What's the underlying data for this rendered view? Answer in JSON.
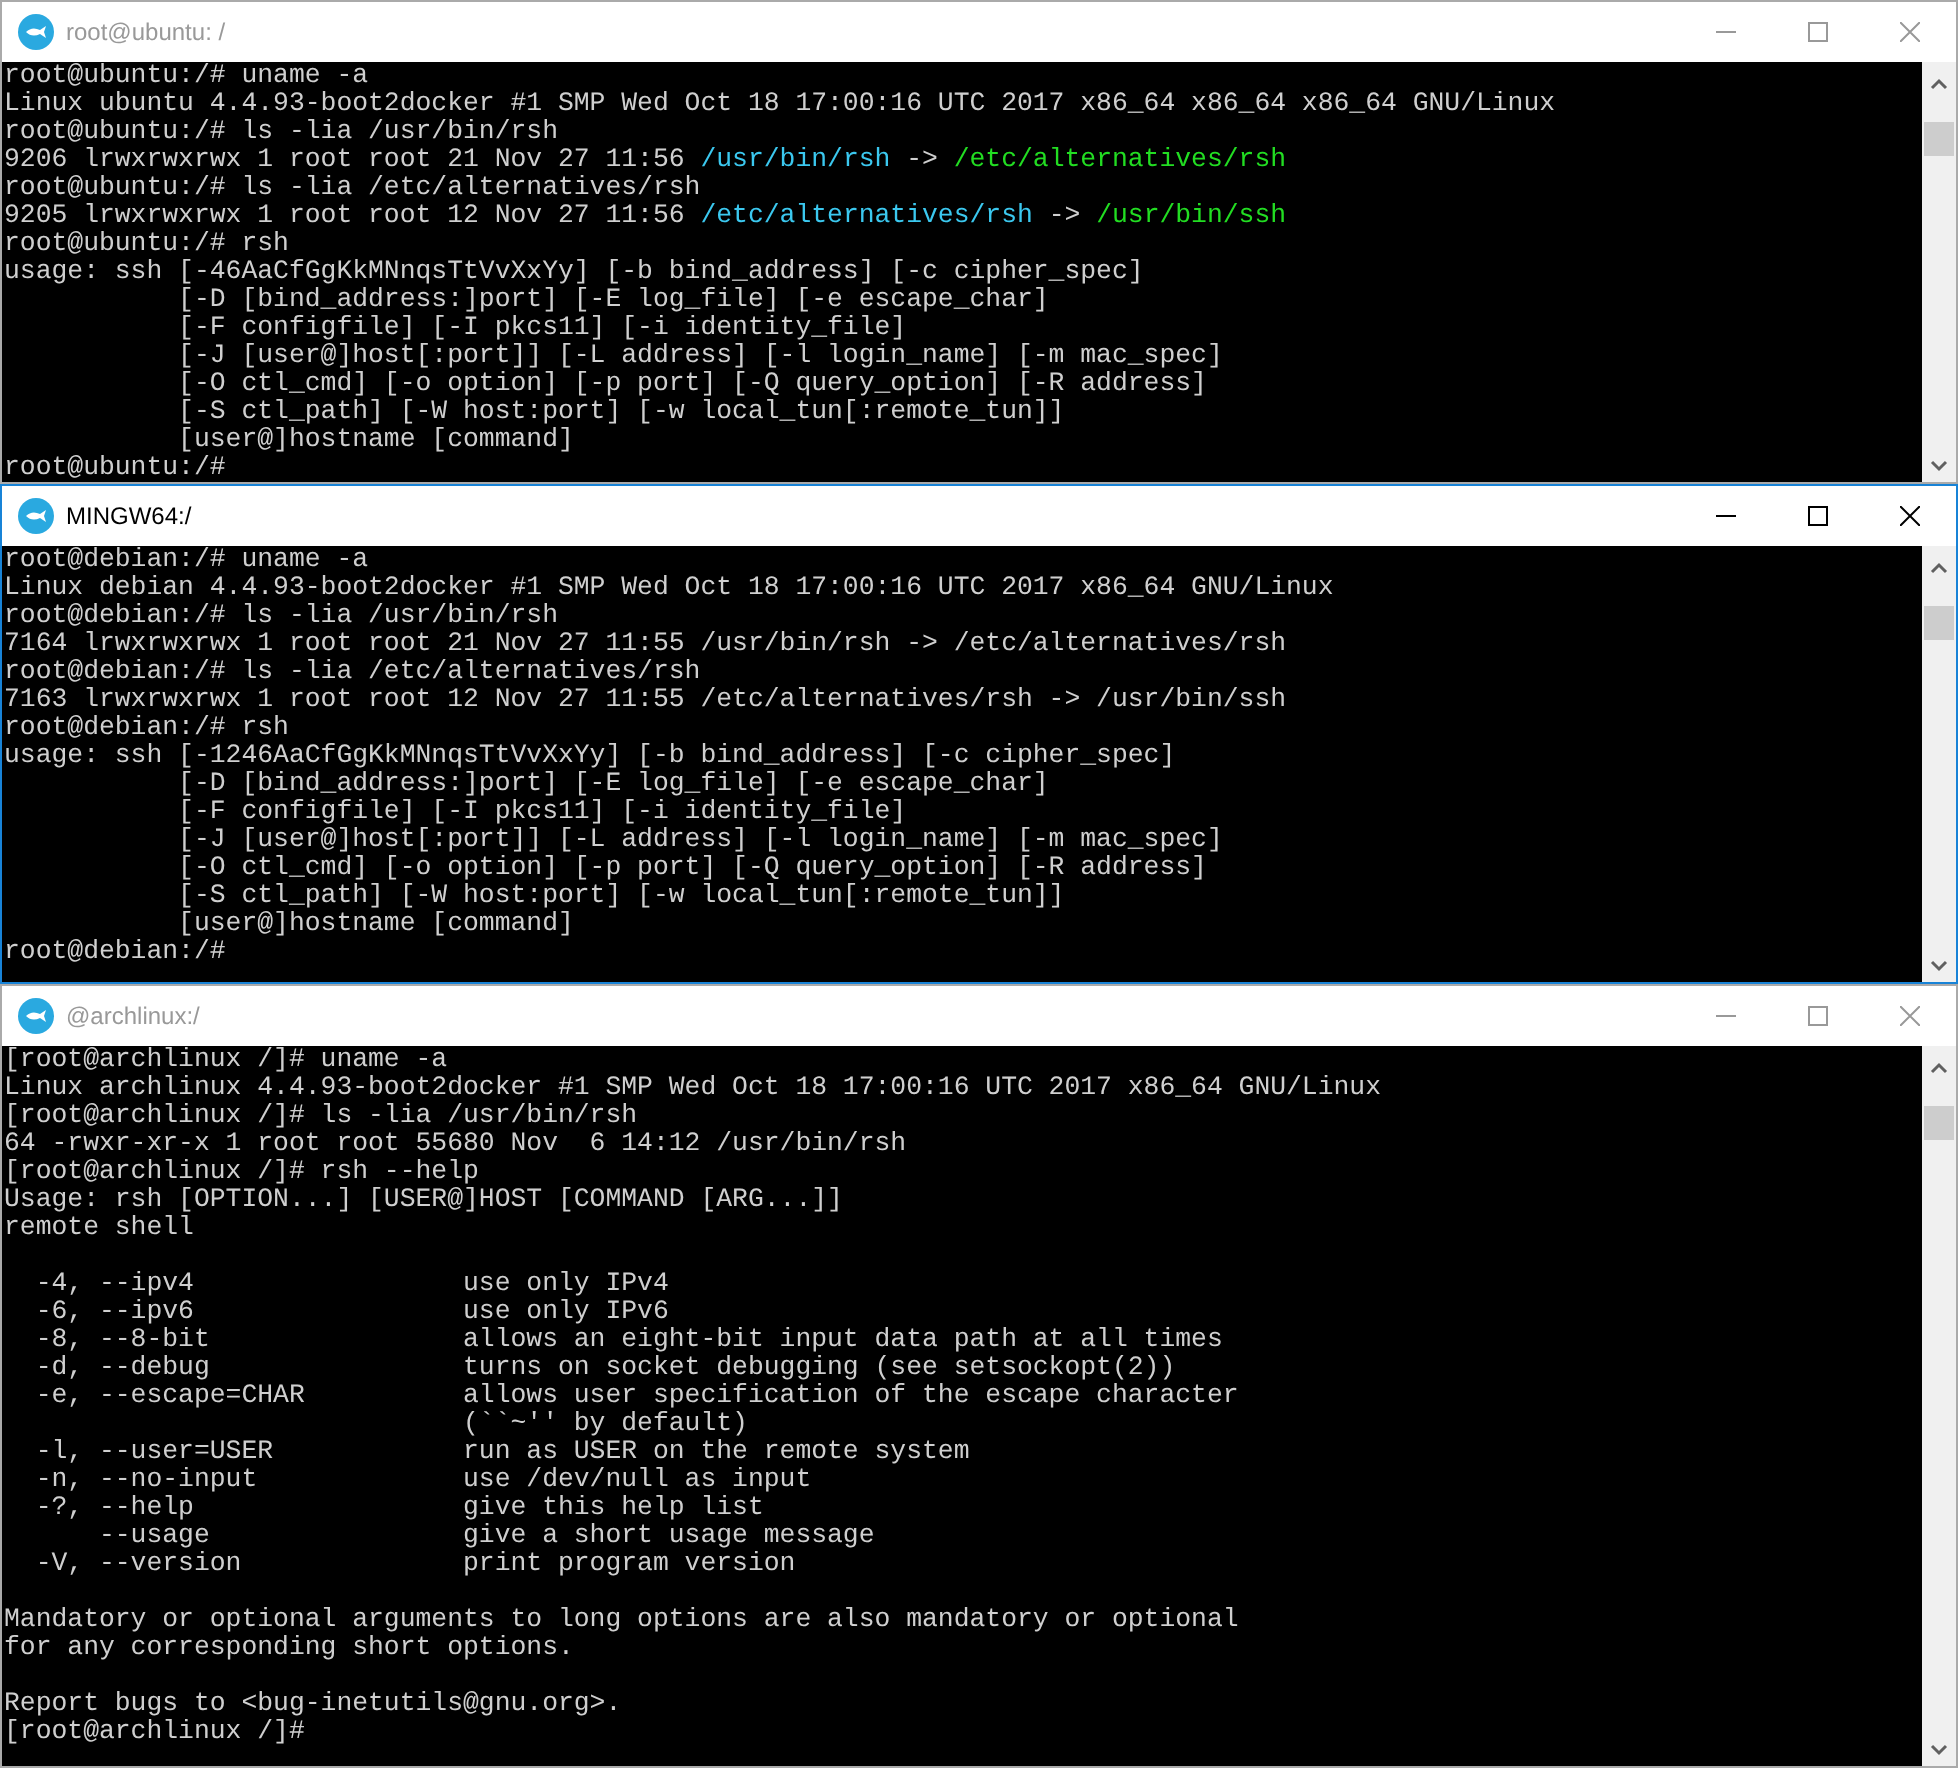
{
  "windows": [
    {
      "title": "root@ubuntu: /",
      "active": false,
      "lines": [
        {
          "kind": "plain",
          "text": "root@ubuntu:/# uname -a"
        },
        {
          "kind": "plain",
          "text": "Linux ubuntu 4.4.93-boot2docker #1 SMP Wed Oct 18 17:00:16 UTC 2017 x86_64 x86_64 x86_64 GNU/Linux"
        },
        {
          "kind": "plain",
          "text": "root@ubuntu:/# ls -lia /usr/bin/rsh"
        },
        {
          "kind": "segments",
          "segments": [
            {
              "text": "9206 lrwxrwxrwx 1 root root 21 Nov 27 11:56 "
            },
            {
              "text": "/usr/bin/rsh",
              "color": "#3bc8ef"
            },
            {
              "text": " -> "
            },
            {
              "text": "/etc/alternatives/rsh",
              "color": "#22dd22"
            }
          ]
        },
        {
          "kind": "plain",
          "text": "root@ubuntu:/# ls -lia /etc/alternatives/rsh"
        },
        {
          "kind": "segments",
          "segments": [
            {
              "text": "9205 lrwxrwxrwx 1 root root 12 Nov 27 11:56 "
            },
            {
              "text": "/etc/alternatives/rsh",
              "color": "#3bc8ef"
            },
            {
              "text": " -> "
            },
            {
              "text": "/usr/bin/ssh",
              "color": "#22dd22"
            }
          ]
        },
        {
          "kind": "plain",
          "text": "root@ubuntu:/# rsh"
        },
        {
          "kind": "plain",
          "text": "usage: ssh [-46AaCfGgKkMNnqsTtVvXxYy] [-b bind_address] [-c cipher_spec]"
        },
        {
          "kind": "plain",
          "text": "           [-D [bind_address:]port] [-E log_file] [-e escape_char]"
        },
        {
          "kind": "plain",
          "text": "           [-F configfile] [-I pkcs11] [-i identity_file]"
        },
        {
          "kind": "plain",
          "text": "           [-J [user@]host[:port]] [-L address] [-l login_name] [-m mac_spec]"
        },
        {
          "kind": "plain",
          "text": "           [-O ctl_cmd] [-o option] [-p port] [-Q query_option] [-R address]"
        },
        {
          "kind": "plain",
          "text": "           [-S ctl_path] [-W host:port] [-w local_tun[:remote_tun]]"
        },
        {
          "kind": "plain",
          "text": "           [user@]hostname [command]"
        },
        {
          "kind": "plain",
          "text": "root@ubuntu:/#"
        }
      ]
    },
    {
      "title": "MINGW64:/",
      "active": true,
      "lines": [
        {
          "kind": "plain",
          "text": "root@debian:/# uname -a"
        },
        {
          "kind": "plain",
          "text": "Linux debian 4.4.93-boot2docker #1 SMP Wed Oct 18 17:00:16 UTC 2017 x86_64 GNU/Linux"
        },
        {
          "kind": "plain",
          "text": "root@debian:/# ls -lia /usr/bin/rsh"
        },
        {
          "kind": "plain",
          "text": "7164 lrwxrwxrwx 1 root root 21 Nov 27 11:55 /usr/bin/rsh -> /etc/alternatives/rsh"
        },
        {
          "kind": "plain",
          "text": "root@debian:/# ls -lia /etc/alternatives/rsh"
        },
        {
          "kind": "plain",
          "text": "7163 lrwxrwxrwx 1 root root 12 Nov 27 11:55 /etc/alternatives/rsh -> /usr/bin/ssh"
        },
        {
          "kind": "plain",
          "text": "root@debian:/# rsh"
        },
        {
          "kind": "plain",
          "text": "usage: ssh [-1246AaCfGgKkMNnqsTtVvXxYy] [-b bind_address] [-c cipher_spec]"
        },
        {
          "kind": "plain",
          "text": "           [-D [bind_address:]port] [-E log_file] [-e escape_char]"
        },
        {
          "kind": "plain",
          "text": "           [-F configfile] [-I pkcs11] [-i identity_file]"
        },
        {
          "kind": "plain",
          "text": "           [-J [user@]host[:port]] [-L address] [-l login_name] [-m mac_spec]"
        },
        {
          "kind": "plain",
          "text": "           [-O ctl_cmd] [-o option] [-p port] [-Q query_option] [-R address]"
        },
        {
          "kind": "plain",
          "text": "           [-S ctl_path] [-W host:port] [-w local_tun[:remote_tun]]"
        },
        {
          "kind": "plain",
          "text": "           [user@]hostname [command]"
        },
        {
          "kind": "plain",
          "text": "root@debian:/#"
        }
      ]
    },
    {
      "title": "@archlinux:/",
      "active": false,
      "lines": [
        {
          "kind": "plain",
          "text": "[root@archlinux /]# uname -a"
        },
        {
          "kind": "plain",
          "text": "Linux archlinux 4.4.93-boot2docker #1 SMP Wed Oct 18 17:00:16 UTC 2017 x86_64 GNU/Linux"
        },
        {
          "kind": "plain",
          "text": "[root@archlinux /]# ls -lia /usr/bin/rsh"
        },
        {
          "kind": "plain",
          "text": "64 -rwxr-xr-x 1 root root 55680 Nov  6 14:12 /usr/bin/rsh"
        },
        {
          "kind": "plain",
          "text": "[root@archlinux /]# rsh --help"
        },
        {
          "kind": "plain",
          "text": "Usage: rsh [OPTION...] [USER@]HOST [COMMAND [ARG...]]"
        },
        {
          "kind": "plain",
          "text": "remote shell"
        },
        {
          "kind": "blank"
        },
        {
          "kind": "plain",
          "text": "  -4, --ipv4                 use only IPv4"
        },
        {
          "kind": "plain",
          "text": "  -6, --ipv6                 use only IPv6"
        },
        {
          "kind": "plain",
          "text": "  -8, --8-bit                allows an eight-bit input data path at all times"
        },
        {
          "kind": "plain",
          "text": "  -d, --debug                turns on socket debugging (see setsockopt(2))"
        },
        {
          "kind": "plain",
          "text": "  -e, --escape=CHAR          allows user specification of the escape character"
        },
        {
          "kind": "plain",
          "text": "                             (``~'' by default)"
        },
        {
          "kind": "plain",
          "text": "  -l, --user=USER            run as USER on the remote system"
        },
        {
          "kind": "plain",
          "text": "  -n, --no-input             use /dev/null as input"
        },
        {
          "kind": "plain",
          "text": "  -?, --help                 give this help list"
        },
        {
          "kind": "plain",
          "text": "      --usage                give a short usage message"
        },
        {
          "kind": "plain",
          "text": "  -V, --version              print program version"
        },
        {
          "kind": "blank"
        },
        {
          "kind": "plain",
          "text": "Mandatory or optional arguments to long options are also mandatory or optional"
        },
        {
          "kind": "plain",
          "text": "for any corresponding short options."
        },
        {
          "kind": "blank"
        },
        {
          "kind": "plain",
          "text": "Report bugs to <bug-inetutils@gnu.org>."
        },
        {
          "kind": "plain",
          "text": "[root@archlinux /]#"
        }
      ]
    }
  ]
}
